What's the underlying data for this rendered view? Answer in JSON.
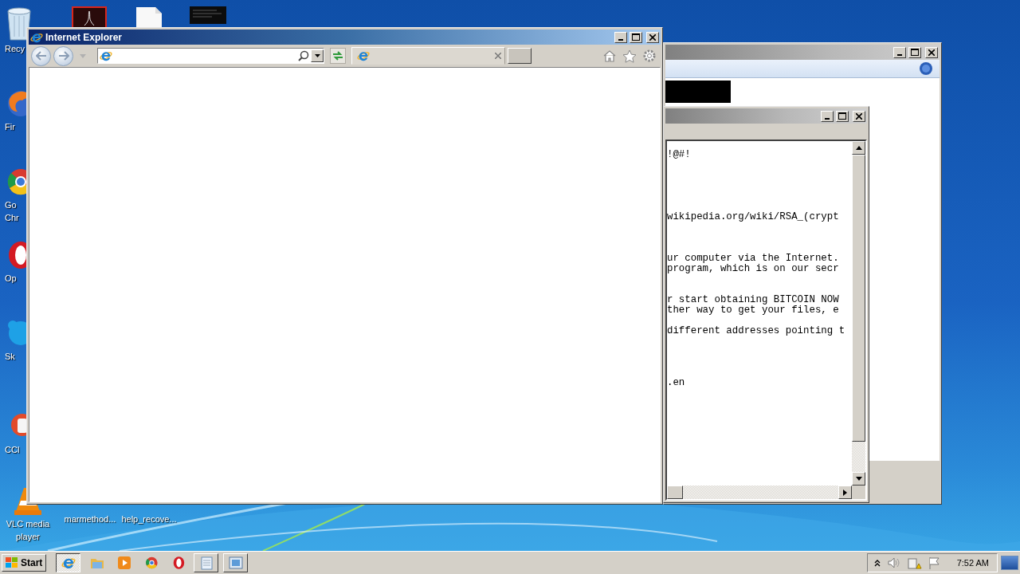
{
  "desktop_icons": [
    {
      "kind": "recycle-bin",
      "label_lines": [
        "Recy"
      ]
    },
    {
      "kind": "fox-globe",
      "label_lines": [
        "Fir"
      ]
    },
    {
      "kind": "color-ring",
      "label_lines": [
        "Go",
        "Chr"
      ]
    },
    {
      "kind": "red-ring",
      "label_lines": [
        "Op"
      ]
    },
    {
      "kind": "blue-bubble",
      "label_lines": [
        "Sk"
      ]
    },
    {
      "kind": "brush",
      "label_lines": [
        "CCl"
      ]
    },
    {
      "kind": "cone",
      "label_lines": [
        "VLC media",
        "player"
      ]
    },
    {
      "kind": "pdf-document"
    },
    {
      "kind": "blank-page"
    },
    {
      "kind": "dark-thumbnail"
    },
    {
      "kind": "hidden",
      "label_lines": [
        "marmethod..."
      ]
    },
    {
      "kind": "hidden",
      "label_lines": [
        "help_recove..."
      ]
    }
  ],
  "browser": {
    "title": "Internet Explorer"
  },
  "notepad": {
    "text": "!@#!\n\n\n\n\n\nwikipedia.org/wiki/RSA_(crypt\n\n\n\nur computer via the Internet.\nprogram, which is on our secr\n\n\nr start obtaining BITCOIN NOW\nther way to get your files, e\n\ndifferent addresses pointing t\n\n\n\n\n.en"
  },
  "taskbar": {
    "start": "Start",
    "items": [
      {
        "kind": "browser",
        "open": true,
        "selected": true
      },
      {
        "kind": "folder",
        "open": false,
        "selected": false
      },
      {
        "kind": "player",
        "open": false,
        "selected": false
      },
      {
        "kind": "color-ring",
        "open": false,
        "selected": false
      },
      {
        "kind": "red-ring",
        "open": false,
        "selected": false
      },
      {
        "kind": "notepad",
        "open": true,
        "selected": false
      },
      {
        "kind": "picture",
        "open": true,
        "selected": false
      }
    ],
    "clock": "7:52 AM"
  }
}
